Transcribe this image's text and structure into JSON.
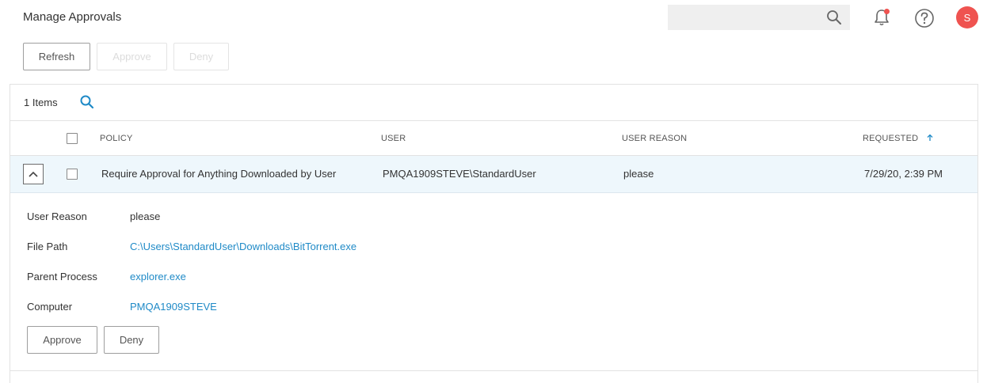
{
  "header": {
    "title": "Manage Approvals",
    "search_placeholder": "",
    "avatar_initial": "S"
  },
  "toolbar": {
    "refresh_label": "Refresh",
    "approve_label": "Approve",
    "deny_label": "Deny"
  },
  "list": {
    "items_count": "1 Items",
    "columns": {
      "policy": "POLICY",
      "user": "USER",
      "user_reason": "USER REASON",
      "requested": "REQUESTED"
    },
    "sort_column": "requested",
    "sort_direction": "ascending",
    "rows": [
      {
        "policy": "Require Approval for Anything Downloaded by User",
        "user": "PMQA1909STEVE\\StandardUser",
        "user_reason": "please",
        "requested": "7/29/20, 2:39 PM",
        "expanded": true
      }
    ]
  },
  "details": {
    "user_reason_label": "User Reason",
    "user_reason_value": "please",
    "file_path_label": "File Path",
    "file_path_value": "C:\\Users\\StandardUser\\Downloads\\BitTorrent.exe",
    "parent_process_label": "Parent Process",
    "parent_process_value": "explorer.exe",
    "computer_label": "Computer",
    "computer_value": "PMQA1909STEVE",
    "approve_label": "Approve",
    "deny_label": "Deny"
  },
  "colors": {
    "accent": "#1f8ac7",
    "avatar": "#ef5350",
    "notification_dot": "#ef5350",
    "selected_row": "#eef7fc"
  }
}
